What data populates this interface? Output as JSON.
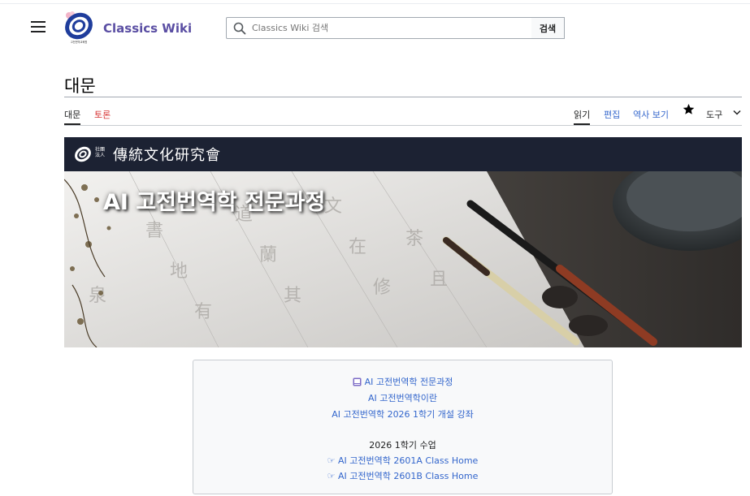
{
  "header": {
    "site_title": "Classics Wiki",
    "search_placeholder": "Classics Wiki 검색",
    "search_button": "검색",
    "logo_caption": "고전번역교육원"
  },
  "page": {
    "title": "대문",
    "tabs_left": [
      {
        "label": "대문",
        "state": "selected"
      },
      {
        "label": "토론",
        "state": "redlink"
      }
    ],
    "tabs_right": [
      {
        "label": "읽기",
        "state": "selected"
      },
      {
        "label": "편집",
        "state": "link"
      },
      {
        "label": "역사 보기",
        "state": "link"
      },
      {
        "label": "도구",
        "state": "dropdown"
      }
    ]
  },
  "banner": {
    "org_prefix_top": "社團",
    "org_prefix_bottom": "法人",
    "org_name": "傳統文化研究會",
    "heading": "AI 고전번역학 전문과정"
  },
  "infobox": {
    "title_link": "AI 고전번역학 전문과정",
    "link_intro": "AI 고전번역학이란",
    "link_courses": "AI 고전번역학 2026 1학기 개설 강좌",
    "section_label": "2026 1학기 수업",
    "class_a": "☞ AI 고전번역학 2601A Class Home",
    "class_b": "☞ AI 고전번역학 2601B Class Home"
  },
  "colors": {
    "link": "#3366cc",
    "redlink": "#d73333",
    "title_brand": "#5a4ea3",
    "banner_bar": "#1c2233"
  },
  "icons": [
    "menu-icon",
    "search-icon",
    "star-icon",
    "chevron-down-icon",
    "book-icon"
  ]
}
